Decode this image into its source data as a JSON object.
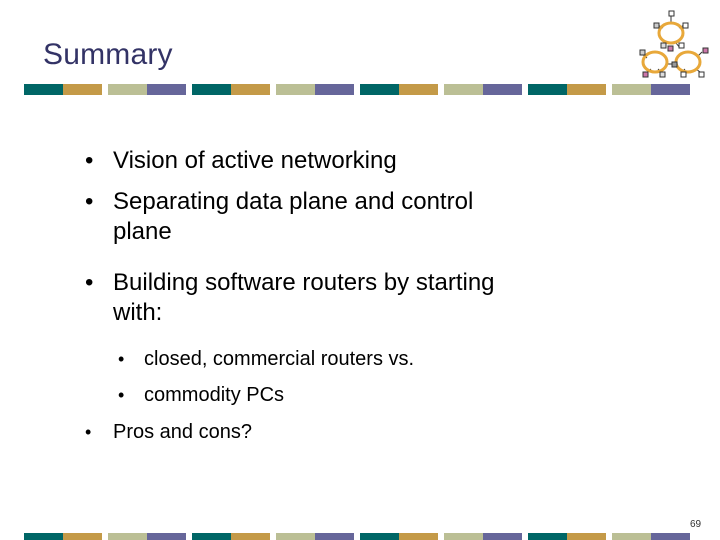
{
  "slide": {
    "title": "Summary",
    "page_number": "69",
    "bullets": [
      {
        "level": 1,
        "lines": [
          "Vision of active networking"
        ]
      },
      {
        "level": 1,
        "lines": [
          "Separating data plane and control",
          "plane"
        ]
      },
      {
        "level": 1,
        "lines": [
          "Building software routers by starting",
          "with:"
        ]
      },
      {
        "level": 2,
        "lines": [
          "closed, commercial routers vs."
        ]
      },
      {
        "level": 2,
        "lines": [
          "commodity PCs"
        ]
      },
      {
        "level": 1,
        "lines": [
          "Pros and cons?"
        ]
      }
    ],
    "bullet_glyph": "•",
    "logo_icon": "network-rings-icon"
  },
  "theme": {
    "title_color": "#333366",
    "bar_colors": [
      "#006666",
      "#c49a48",
      "#bbbf95",
      "#66669a"
    ],
    "logo_ring_color": "#e8a83a"
  }
}
